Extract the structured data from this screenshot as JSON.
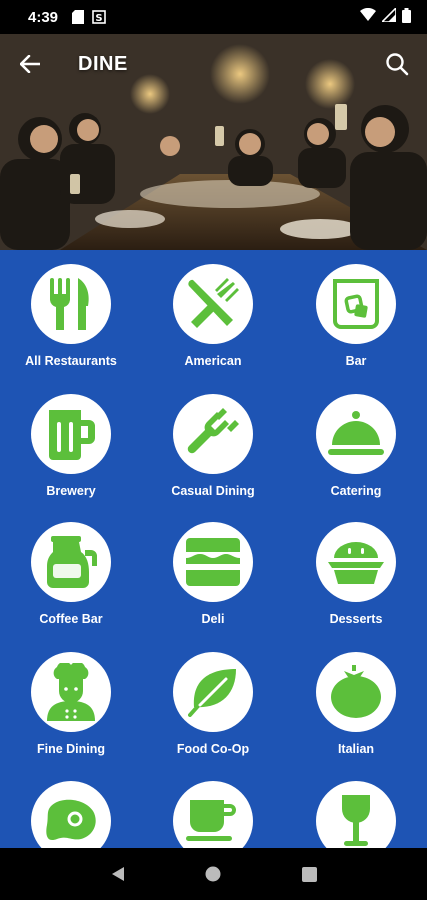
{
  "status_bar": {
    "time": "4:39"
  },
  "header": {
    "title": "DINE"
  },
  "categories": [
    {
      "label": "All Restaurants",
      "icon": "fork-knife-icon"
    },
    {
      "label": "American",
      "icon": "crossed-utensils-icon"
    },
    {
      "label": "Bar",
      "icon": "glass-ice-icon"
    },
    {
      "label": "Brewery",
      "icon": "beer-mug-icon"
    },
    {
      "label": "Casual Dining",
      "icon": "fork-icon"
    },
    {
      "label": "Catering",
      "icon": "cloche-icon"
    },
    {
      "label": "Coffee Bar",
      "icon": "coffee-pot-icon"
    },
    {
      "label": "Deli",
      "icon": "sandwich-icon"
    },
    {
      "label": "Desserts",
      "icon": "pie-icon"
    },
    {
      "label": "Fine Dining",
      "icon": "chef-icon"
    },
    {
      "label": "Food Co-Op",
      "icon": "leaf-icon"
    },
    {
      "label": "Italian",
      "icon": "tomato-icon"
    },
    {
      "label": "",
      "icon": "steak-icon"
    },
    {
      "label": "",
      "icon": "coffee-cup-icon"
    },
    {
      "label": "",
      "icon": "wine-glass-icon"
    }
  ],
  "colors": {
    "accent_blue": "#1e54b4",
    "icon_green": "#5cbf3b"
  }
}
